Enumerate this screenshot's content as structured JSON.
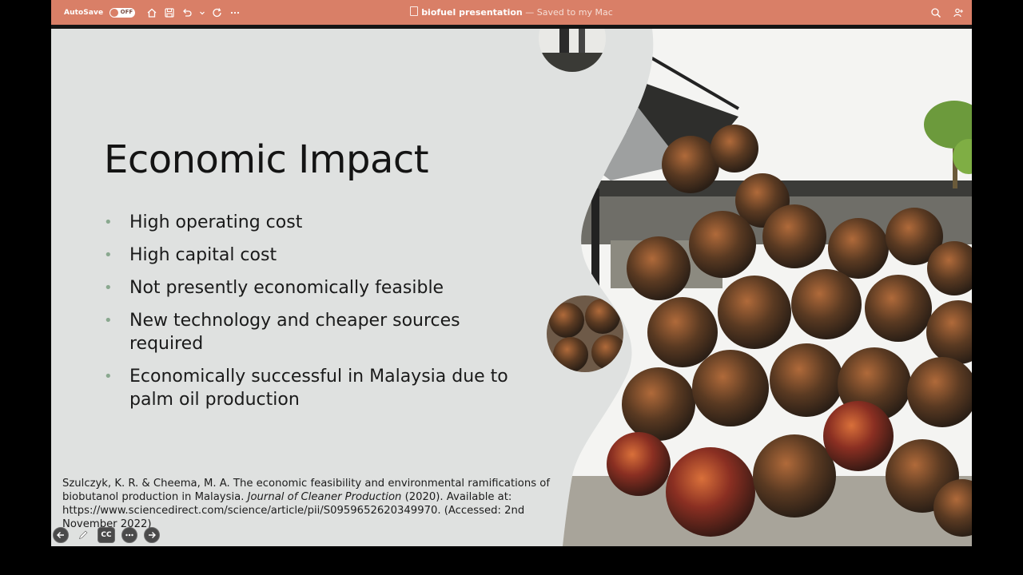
{
  "titlebar": {
    "autosave_label": "AutoSave",
    "autosave_state": "OFF",
    "document_name": "biofuel presentation",
    "document_status": "— Saved to my Mac",
    "background_color": "#d97f67",
    "icons": [
      "home-icon",
      "save-icon",
      "undo-icon",
      "chevron-down-icon",
      "redo-icon",
      "more-icon",
      "search-icon",
      "share-icon"
    ]
  },
  "slide": {
    "title": "Economic Impact",
    "bullets": [
      "High operating cost",
      "High capital cost",
      "Not presently economically feasible",
      "New technology and cheaper sources required",
      "Economically successful in Malaysia due to palm oil production"
    ],
    "citation": {
      "authors_title": "Szulczyk, K. R. & Cheema, M. A. The economic feasibility and environmental ramifications of biobutanol production in Malaysia. ",
      "journal": "Journal of Cleaner Production",
      "rest": " (2020). Available at: https://www.sciencedirect.com/science/article/pii/S0959652620349970. (Accessed: 2nd November 2022)"
    },
    "background_color": "#dfe1e0",
    "accent_color": "#8aa88f",
    "image_subject": "pile of palm oil fruit bunches"
  },
  "controls": {
    "icons": [
      "arrow-left-icon",
      "pen-icon",
      "captions-icon",
      "more-icon",
      "arrow-right-icon"
    ],
    "cc_label": "CC"
  }
}
